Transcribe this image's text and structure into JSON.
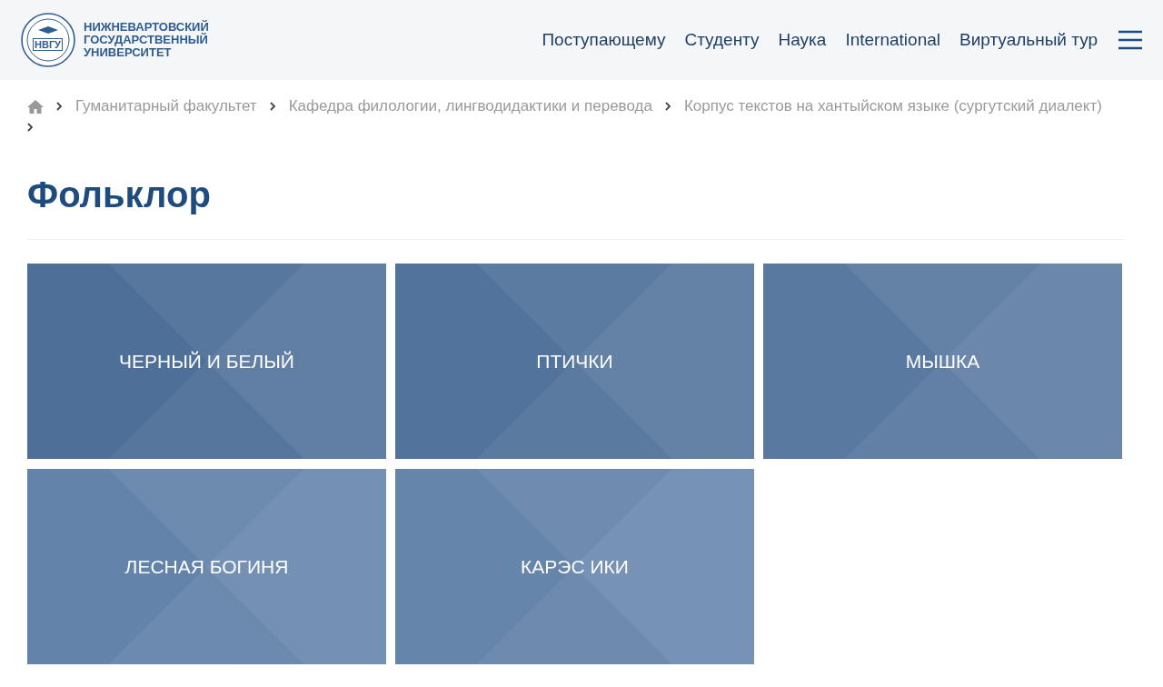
{
  "header": {
    "logo": {
      "emblem_text": "НВГУ",
      "name_lines": [
        "НИЖНЕВАРТОВСКИЙ",
        "ГОСУДАРСТВЕННЫЙ",
        "УНИВЕРСИТЕТ"
      ]
    },
    "nav": [
      "Поступающему",
      "Студенту",
      "Наука",
      "International",
      "Виртуальный тур"
    ]
  },
  "breadcrumbs": [
    "Гуманитарный факультет",
    "Кафедра филологии, лингводидактики и перевода",
    "Корпус текстов на хантыйском языке (сургутский диалект)"
  ],
  "title": "Фольклор",
  "tiles": [
    {
      "label": "ЧЕРНЫЙ И БЕЛЫЙ",
      "color": "#4e6f98"
    },
    {
      "label": "ПТИЧКИ",
      "color": "#52739b"
    },
    {
      "label": "МЫШКА",
      "color": "#5a79a0"
    },
    {
      "label": "ЛЕСНАЯ БОГИНЯ",
      "color": "#6483aa"
    },
    {
      "label": "КАРЭС ИКИ",
      "color": "#6685ab"
    }
  ]
}
